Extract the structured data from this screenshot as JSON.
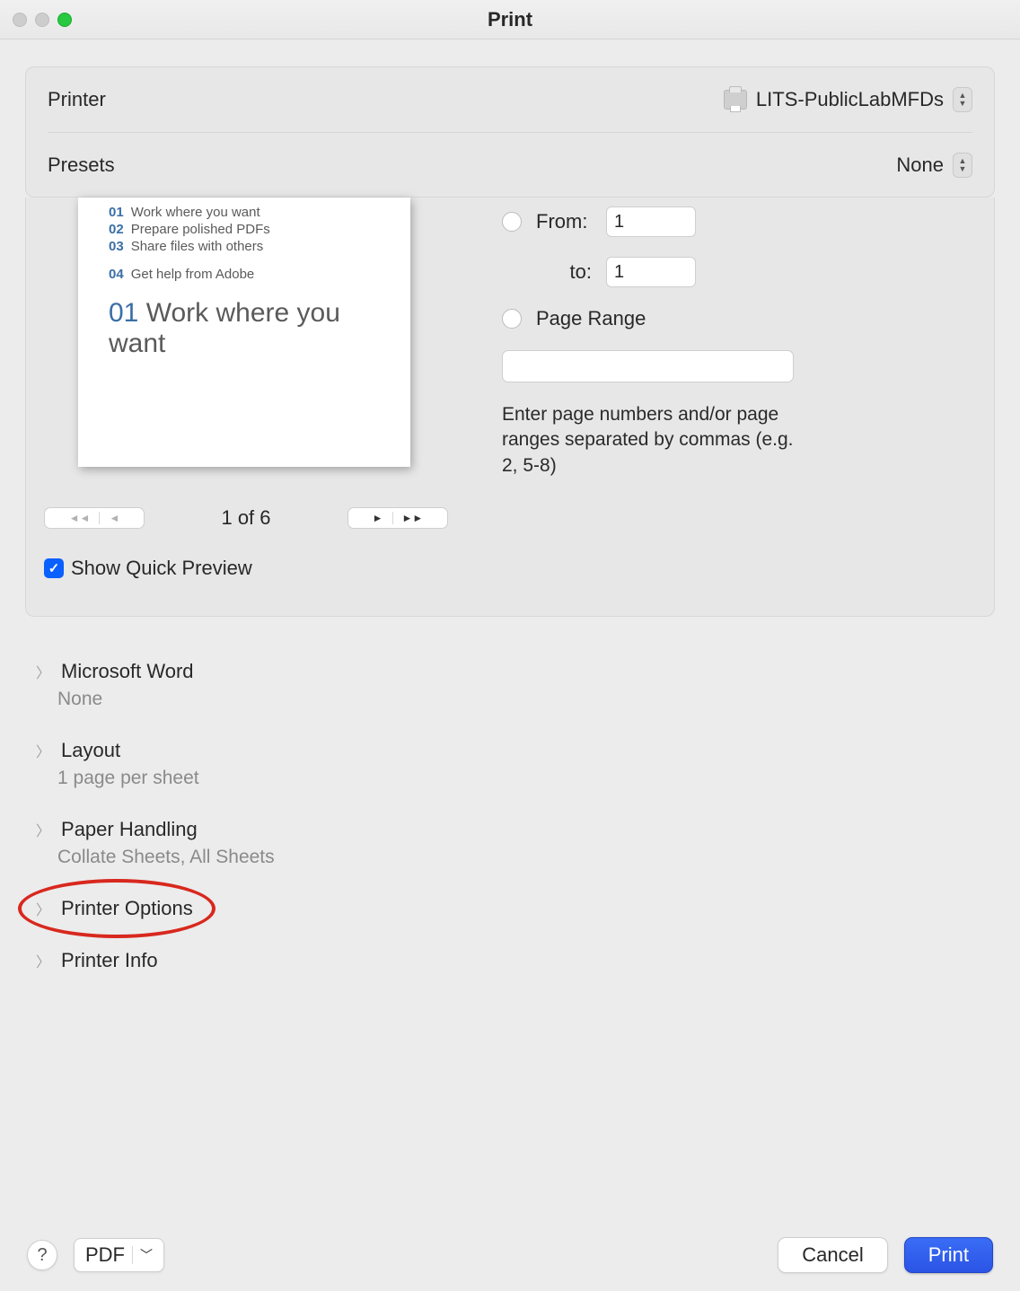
{
  "title": "Print",
  "group": {
    "printer_label": "Printer",
    "printer_value": "LITS-PublicLabMFDs",
    "presets_label": "Presets",
    "presets_value": "None"
  },
  "preview": {
    "toc": [
      {
        "num": "01",
        "txt": "Work where you want"
      },
      {
        "num": "02",
        "txt": "Prepare polished PDFs"
      },
      {
        "num": "03",
        "txt": "Share files with others"
      },
      {
        "num": "04",
        "txt": "Get help from Adobe"
      }
    ],
    "heading_num": "01",
    "heading_txt1": "Work where you",
    "heading_txt2": "want",
    "page_indicator": "1 of 6",
    "show_quick_preview": "Show Quick Preview"
  },
  "range": {
    "from_label": "From:",
    "from_value": "1",
    "to_label": "to:",
    "to_value": "1",
    "page_range_label": "Page Range",
    "hint": "Enter page numbers and/or page ranges separated by commas (e.g. 2, 5-8)"
  },
  "disclosures": [
    {
      "title": "Microsoft Word",
      "sub": "None"
    },
    {
      "title": "Layout",
      "sub": "1 page per sheet"
    },
    {
      "title": "Paper Handling",
      "sub": "Collate Sheets, All Sheets"
    },
    {
      "title": "Printer Options",
      "sub": ""
    },
    {
      "title": "Printer Info",
      "sub": ""
    }
  ],
  "footer": {
    "pdf_label": "PDF",
    "cancel": "Cancel",
    "print": "Print"
  }
}
